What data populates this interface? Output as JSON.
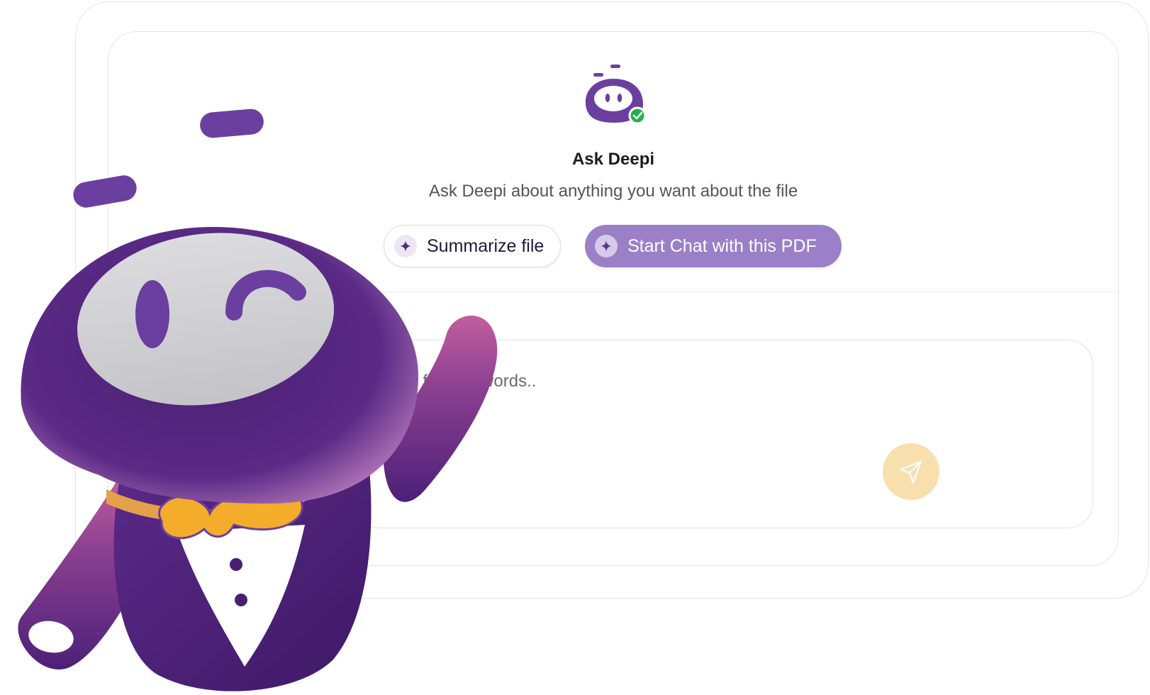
{
  "assistant": {
    "title": "Ask Deepi",
    "subtitle": "Ask Deepi about anything you want about the file"
  },
  "actions": {
    "summarize_label": "Summarize file",
    "start_chat_label": "Start Chat with this PDF"
  },
  "input": {
    "placeholder": ", or find keywords.."
  },
  "icons": {
    "logo": "deepi-logo-icon",
    "verified": "check-badge-icon",
    "sparkle": "sparkle-icon",
    "send": "send-icon",
    "mascot": "deepi-mascot"
  },
  "colors": {
    "brand_purple": "#6b3f9f",
    "chat_button": "#9b80c8",
    "send_button": "#f8dfae",
    "verified_green": "#22b24c",
    "bowtie": "#f3ad2b"
  }
}
